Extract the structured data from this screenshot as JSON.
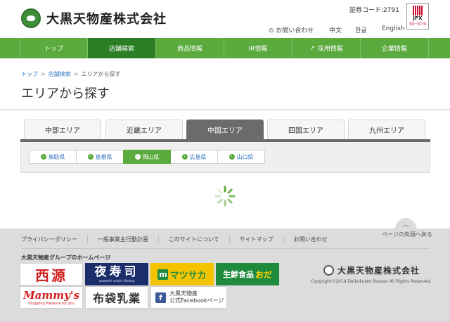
{
  "header": {
    "company_name": "大黒天物産株式会社",
    "stock_code": "証券コード:2791",
    "jpx_label": "JPX",
    "jpx_sub": "東証一部上場",
    "utility_links": {
      "contact": "お問い合わせ",
      "chinese": "中文",
      "korean": "한글",
      "english": "English"
    }
  },
  "nav": {
    "items": [
      {
        "label": "トップ",
        "icon": ""
      },
      {
        "label": "店舗検索",
        "icon": ""
      },
      {
        "label": "商品情報",
        "icon": ""
      },
      {
        "label": "IR情報",
        "icon": ""
      },
      {
        "label": "採用情報",
        "icon": "↗"
      },
      {
        "label": "企業情報",
        "icon": ""
      }
    ],
    "active_index": 1
  },
  "breadcrumb": {
    "top": "トップ",
    "store_search": "店舗検索",
    "current": "エリアから探す"
  },
  "page_title": "エリアから探す",
  "area_tabs": {
    "items": [
      "中部エリア",
      "近畿エリア",
      "中国エリア",
      "四国エリア",
      "九州エリア"
    ],
    "active_index": 2
  },
  "prefectures": {
    "items": [
      "鳥取県",
      "島根県",
      "岡山県",
      "広島県",
      "山口県"
    ],
    "active_index": 2,
    "arrow": "›"
  },
  "page_top": {
    "arrow": "︿",
    "label": "ページの先頭へ戻る"
  },
  "footer": {
    "links": [
      "プライバシーポリシー",
      "一般事業主行動計画",
      "このサイトについて",
      "サイトマップ",
      "お問い合わせ"
    ],
    "group_title": "大黒天物産グループのホームページ",
    "banners": {
      "nishigen": "西源",
      "yojuji": "夜寿司",
      "yojuji_sub": "yozushi sushi dining",
      "matsusaka_m": "m",
      "matsusaka": "マツサカ",
      "oda_1": "生鮮食品",
      "oda_2": "おだ",
      "mammys": "Mammy's",
      "mammys_sub": "Shopping Pleasure for you",
      "hotei": "布袋乳業",
      "fb_icon": "f",
      "fb_line1": "大黒天物産",
      "fb_line2": "公式Facebookページ"
    },
    "company_name": "大黒天物産株式会社",
    "copyright": "Copyright©2014 Daikokuten Bussan All Rights Reserved."
  },
  "colors": {
    "nav_green": "#5aaa3d",
    "nav_active": "#2b7e24",
    "tab_active": "#6b6b6b",
    "link_blue": "#2f73c0"
  }
}
